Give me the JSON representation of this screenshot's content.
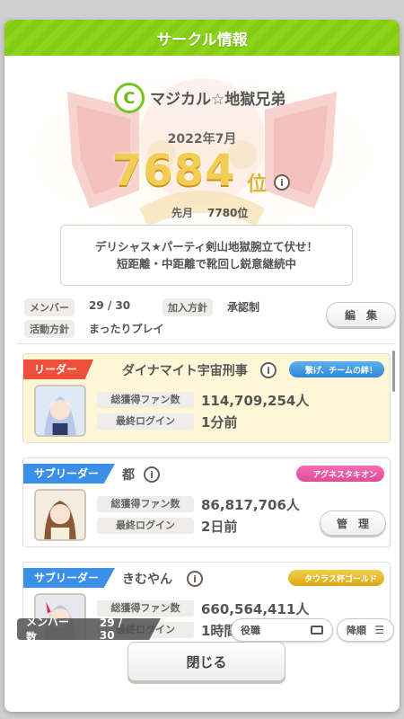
{
  "header": {
    "title": "サークル情報"
  },
  "circle": {
    "icon_letter": "C",
    "name": "マジカル☆地獄兄弟",
    "rank_month": "2022年7月",
    "rank": "7684",
    "rank_unit": "位",
    "prev_label": "先月",
    "prev_value": "7780位",
    "slogan_line1": "デリシャス★パーティ剣山地獄腕立て伏せ！",
    "slogan_line2": "短距離・中距離で靴回し鋭意継続中"
  },
  "meta": {
    "members_label": "メンバー",
    "members_value": "29 / 30",
    "join_label": "加入方針",
    "join_value": "承認制",
    "activity_label": "活動方針",
    "activity_value": "まったりプレイ",
    "edit_button": "編　集"
  },
  "members": [
    {
      "role": "リーダー",
      "name": "ダイナマイト宇宙刑事",
      "badge": "繋げ、チームの絆！",
      "fans_label": "総獲得ファン数",
      "fans": "114,709,254人",
      "login_label": "最終ログイン",
      "login": "1分前"
    },
    {
      "role": "サブリーダー",
      "name": "都",
      "badge": "アグネスタキオン",
      "fans_label": "総獲得ファン数",
      "fans": "86,817,706人",
      "login_label": "最終ログイン",
      "login": "2日前",
      "manage_button": "管　理"
    },
    {
      "role": "サブリーダー",
      "name": "きむやん",
      "badge": "タウラス杯ゴールド",
      "fans_label": "総獲得ファン数",
      "fans": "660,564,411人",
      "login_label": "最終ログイン",
      "login": "1時間"
    }
  ],
  "footer_bar": {
    "count_label": "メンバー数",
    "count_value": "29 / 30",
    "sort_role": "役職",
    "sort_order": "降順"
  },
  "close_button": "閉じる",
  "colors": {
    "header_green": "#8fd41c",
    "leader_red": "#ee4f3a",
    "subleader_blue": "#3a8fe6",
    "rank_gold": "#f3cc56"
  }
}
